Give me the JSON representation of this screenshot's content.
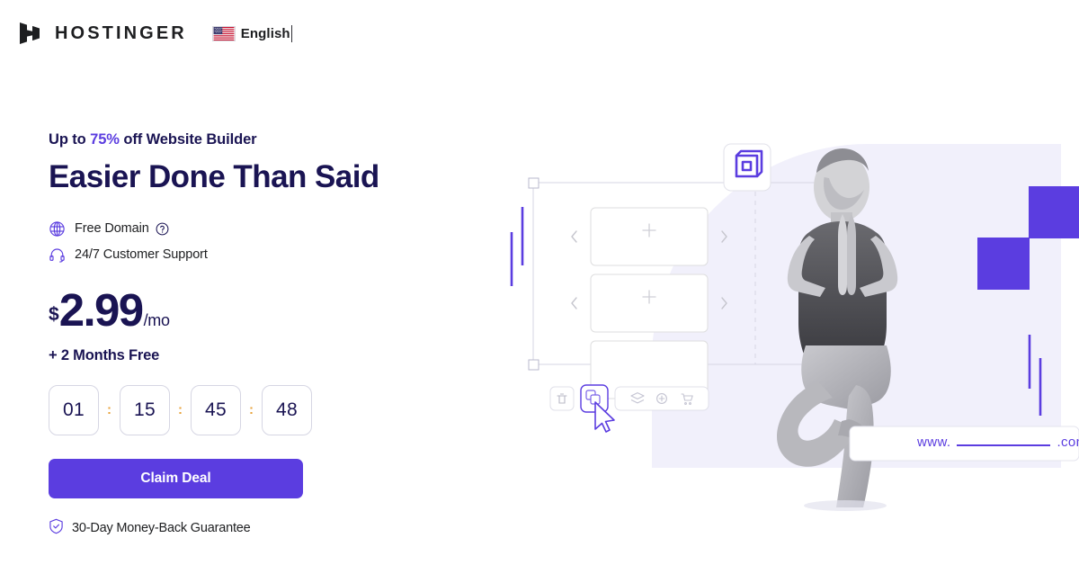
{
  "header": {
    "logo_icon": "hostinger-h-logo",
    "brand": "HOSTINGER",
    "flag_icon": "us-flag-icon",
    "language": "English"
  },
  "hero": {
    "eyebrow_prefix": "Up to ",
    "eyebrow_discount": "75%",
    "eyebrow_suffix": " off Website Builder",
    "headline": "Easier Done Than Said",
    "features": [
      {
        "icon": "globe-icon",
        "label": "Free Domain",
        "has_help": true,
        "help_icon": "question-circle-icon"
      },
      {
        "icon": "headset-icon",
        "label": "24/7 Customer Support",
        "has_help": false
      }
    ],
    "price": {
      "currency": "$",
      "amount": "2.99",
      "period": "/mo"
    },
    "bonus": "+ 2 Months Free",
    "countdown": {
      "separator": ":",
      "units": [
        "01",
        "15",
        "45",
        "48"
      ]
    },
    "cta_label": "Claim Deal",
    "guarantee": {
      "icon": "shield-check-icon",
      "label": "30-Day Money-Back Guarantee"
    }
  },
  "illustration": {
    "badge_icon": "hostinger-cube-icon",
    "placeholder_icon": "plus-icon",
    "arrow_prev_icon": "chevron-left-icon",
    "arrow_next_icon": "chevron-right-icon",
    "toolbar": [
      {
        "icon": "trash-icon",
        "active": false
      },
      {
        "icon": "duplicate-icon",
        "active": true
      },
      {
        "icon": "layers-icon",
        "active": false
      },
      {
        "icon": "plus-circle-icon",
        "active": false
      },
      {
        "icon": "cart-icon",
        "active": false
      }
    ],
    "cursor_icon": "mouse-pointer-icon",
    "domain_bar": {
      "prefix": "www.",
      "blank": "__________",
      "suffix": ".com"
    },
    "person_alt": "woman-in-yoga-tree-pose"
  },
  "colors": {
    "brand_purple": "#5b3de0",
    "headline_navy": "#1a1453",
    "timer_separator": "#e8a33d",
    "panel_lavender": "#f1f0fb",
    "border_grey": "#d6d6e3"
  }
}
